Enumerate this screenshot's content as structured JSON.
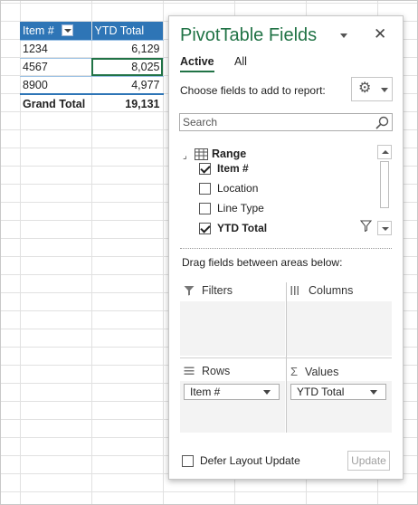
{
  "pivot_table": {
    "headers": {
      "col1": "Item #",
      "col2": "YTD Total"
    },
    "rows": [
      {
        "item": "1234",
        "total": "6,129"
      },
      {
        "item": "4567",
        "total": "8,025"
      },
      {
        "item": "8900",
        "total": "4,977"
      }
    ],
    "grand_total": {
      "label": "Grand Total",
      "value": "19,131"
    }
  },
  "pane": {
    "title": "PivotTable Fields",
    "close_glyph": "✕",
    "tabs": [
      {
        "label": "Active"
      },
      {
        "label": "All"
      }
    ],
    "choose_label": "Choose fields to add to report:",
    "gear_glyph": "⚙",
    "search_placeholder": "Search",
    "range_label": "Range",
    "collapse_glyph": "⌟",
    "fields": [
      {
        "label": "Item #",
        "checked": true
      },
      {
        "label": "Location",
        "checked": false
      },
      {
        "label": "Line Type",
        "checked": false
      },
      {
        "label": "YTD Total",
        "checked": true
      }
    ],
    "drag_label": "Drag fields between areas below:",
    "areas": {
      "filters": {
        "label": "Filters",
        "icon": "filter-icon"
      },
      "columns": {
        "label": "Columns",
        "icon": "columns-icon"
      },
      "rows": {
        "label": "Rows",
        "icon": "rows-icon",
        "field": "Item #"
      },
      "values": {
        "label": "Values",
        "icon": "sigma-icon",
        "glyph": "Σ",
        "field": "YTD Total"
      }
    },
    "defer_label": "Defer Layout Update",
    "update_label": "Update"
  },
  "colors": {
    "accent": "#217346",
    "header_blue": "#2e75b6"
  }
}
